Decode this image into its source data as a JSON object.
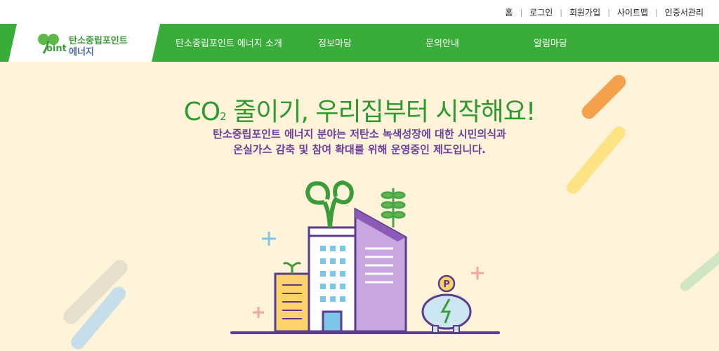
{
  "util_links": [
    "홈",
    "로그인",
    "회원가입",
    "사이트맵",
    "인증서관리"
  ],
  "logo": {
    "line1": "탄소중립포인트",
    "line2": "에너지",
    "oint": "oint"
  },
  "nav": {
    "items": [
      "탄소중립포인트 에너지 소개",
      "정보마당",
      "문의안내",
      "알림마당"
    ]
  },
  "hero": {
    "headline_pre": "CO",
    "headline_sub": "2",
    "headline_post": " 줄이기, 우리집부터 시작해요!",
    "desc_line1": "탄소중립포인트 에너지 분야는 저탄소 녹색성장에 대한 시민의식과",
    "desc_line2": "온실가스 감축 및 참여 확대를 위해 운영중인 제도입니다.",
    "coin_label": "P"
  },
  "colors": {
    "nav_green": "#3aac3a",
    "headline_green": "#2c9a2c",
    "desc_purple": "#6b3fa0",
    "hero_bg": "#fff3da"
  }
}
